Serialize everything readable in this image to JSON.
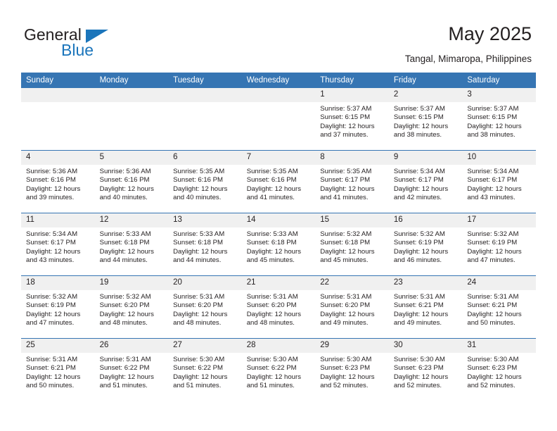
{
  "brand": {
    "name_top": "General",
    "name_bottom": "Blue",
    "accent_color": "#1b75bb"
  },
  "header": {
    "title": "May 2025",
    "location": "Tangal, Mimaropa, Philippines"
  },
  "theme": {
    "header_row_bg": "#3675b3",
    "daynum_bg": "#f0f0f0",
    "grid_line": "#3675b3",
    "text": "#231f20"
  },
  "weekday_headers": [
    "Sunday",
    "Monday",
    "Tuesday",
    "Wednesday",
    "Thursday",
    "Friday",
    "Saturday"
  ],
  "labels": {
    "sunrise": "Sunrise:",
    "sunset": "Sunset:",
    "daylight": "Daylight:"
  },
  "weeks": [
    [
      {
        "empty": true
      },
      {
        "empty": true
      },
      {
        "empty": true
      },
      {
        "empty": true
      },
      {
        "day": "1",
        "sunrise": "Sunrise: 5:37 AM",
        "sunset": "Sunset: 6:15 PM",
        "daylight_1": "Daylight: 12 hours",
        "daylight_2": "and 37 minutes."
      },
      {
        "day": "2",
        "sunrise": "Sunrise: 5:37 AM",
        "sunset": "Sunset: 6:15 PM",
        "daylight_1": "Daylight: 12 hours",
        "daylight_2": "and 38 minutes."
      },
      {
        "day": "3",
        "sunrise": "Sunrise: 5:37 AM",
        "sunset": "Sunset: 6:15 PM",
        "daylight_1": "Daylight: 12 hours",
        "daylight_2": "and 38 minutes."
      }
    ],
    [
      {
        "day": "4",
        "sunrise": "Sunrise: 5:36 AM",
        "sunset": "Sunset: 6:16 PM",
        "daylight_1": "Daylight: 12 hours",
        "daylight_2": "and 39 minutes."
      },
      {
        "day": "5",
        "sunrise": "Sunrise: 5:36 AM",
        "sunset": "Sunset: 6:16 PM",
        "daylight_1": "Daylight: 12 hours",
        "daylight_2": "and 40 minutes."
      },
      {
        "day": "6",
        "sunrise": "Sunrise: 5:35 AM",
        "sunset": "Sunset: 6:16 PM",
        "daylight_1": "Daylight: 12 hours",
        "daylight_2": "and 40 minutes."
      },
      {
        "day": "7",
        "sunrise": "Sunrise: 5:35 AM",
        "sunset": "Sunset: 6:16 PM",
        "daylight_1": "Daylight: 12 hours",
        "daylight_2": "and 41 minutes."
      },
      {
        "day": "8",
        "sunrise": "Sunrise: 5:35 AM",
        "sunset": "Sunset: 6:17 PM",
        "daylight_1": "Daylight: 12 hours",
        "daylight_2": "and 41 minutes."
      },
      {
        "day": "9",
        "sunrise": "Sunrise: 5:34 AM",
        "sunset": "Sunset: 6:17 PM",
        "daylight_1": "Daylight: 12 hours",
        "daylight_2": "and 42 minutes."
      },
      {
        "day": "10",
        "sunrise": "Sunrise: 5:34 AM",
        "sunset": "Sunset: 6:17 PM",
        "daylight_1": "Daylight: 12 hours",
        "daylight_2": "and 43 minutes."
      }
    ],
    [
      {
        "day": "11",
        "sunrise": "Sunrise: 5:34 AM",
        "sunset": "Sunset: 6:17 PM",
        "daylight_1": "Daylight: 12 hours",
        "daylight_2": "and 43 minutes."
      },
      {
        "day": "12",
        "sunrise": "Sunrise: 5:33 AM",
        "sunset": "Sunset: 6:18 PM",
        "daylight_1": "Daylight: 12 hours",
        "daylight_2": "and 44 minutes."
      },
      {
        "day": "13",
        "sunrise": "Sunrise: 5:33 AM",
        "sunset": "Sunset: 6:18 PM",
        "daylight_1": "Daylight: 12 hours",
        "daylight_2": "and 44 minutes."
      },
      {
        "day": "14",
        "sunrise": "Sunrise: 5:33 AM",
        "sunset": "Sunset: 6:18 PM",
        "daylight_1": "Daylight: 12 hours",
        "daylight_2": "and 45 minutes."
      },
      {
        "day": "15",
        "sunrise": "Sunrise: 5:32 AM",
        "sunset": "Sunset: 6:18 PM",
        "daylight_1": "Daylight: 12 hours",
        "daylight_2": "and 45 minutes."
      },
      {
        "day": "16",
        "sunrise": "Sunrise: 5:32 AM",
        "sunset": "Sunset: 6:19 PM",
        "daylight_1": "Daylight: 12 hours",
        "daylight_2": "and 46 minutes."
      },
      {
        "day": "17",
        "sunrise": "Sunrise: 5:32 AM",
        "sunset": "Sunset: 6:19 PM",
        "daylight_1": "Daylight: 12 hours",
        "daylight_2": "and 47 minutes."
      }
    ],
    [
      {
        "day": "18",
        "sunrise": "Sunrise: 5:32 AM",
        "sunset": "Sunset: 6:19 PM",
        "daylight_1": "Daylight: 12 hours",
        "daylight_2": "and 47 minutes."
      },
      {
        "day": "19",
        "sunrise": "Sunrise: 5:32 AM",
        "sunset": "Sunset: 6:20 PM",
        "daylight_1": "Daylight: 12 hours",
        "daylight_2": "and 48 minutes."
      },
      {
        "day": "20",
        "sunrise": "Sunrise: 5:31 AM",
        "sunset": "Sunset: 6:20 PM",
        "daylight_1": "Daylight: 12 hours",
        "daylight_2": "and 48 minutes."
      },
      {
        "day": "21",
        "sunrise": "Sunrise: 5:31 AM",
        "sunset": "Sunset: 6:20 PM",
        "daylight_1": "Daylight: 12 hours",
        "daylight_2": "and 48 minutes."
      },
      {
        "day": "22",
        "sunrise": "Sunrise: 5:31 AM",
        "sunset": "Sunset: 6:20 PM",
        "daylight_1": "Daylight: 12 hours",
        "daylight_2": "and 49 minutes."
      },
      {
        "day": "23",
        "sunrise": "Sunrise: 5:31 AM",
        "sunset": "Sunset: 6:21 PM",
        "daylight_1": "Daylight: 12 hours",
        "daylight_2": "and 49 minutes."
      },
      {
        "day": "24",
        "sunrise": "Sunrise: 5:31 AM",
        "sunset": "Sunset: 6:21 PM",
        "daylight_1": "Daylight: 12 hours",
        "daylight_2": "and 50 minutes."
      }
    ],
    [
      {
        "day": "25",
        "sunrise": "Sunrise: 5:31 AM",
        "sunset": "Sunset: 6:21 PM",
        "daylight_1": "Daylight: 12 hours",
        "daylight_2": "and 50 minutes."
      },
      {
        "day": "26",
        "sunrise": "Sunrise: 5:31 AM",
        "sunset": "Sunset: 6:22 PM",
        "daylight_1": "Daylight: 12 hours",
        "daylight_2": "and 51 minutes."
      },
      {
        "day": "27",
        "sunrise": "Sunrise: 5:30 AM",
        "sunset": "Sunset: 6:22 PM",
        "daylight_1": "Daylight: 12 hours",
        "daylight_2": "and 51 minutes."
      },
      {
        "day": "28",
        "sunrise": "Sunrise: 5:30 AM",
        "sunset": "Sunset: 6:22 PM",
        "daylight_1": "Daylight: 12 hours",
        "daylight_2": "and 51 minutes."
      },
      {
        "day": "29",
        "sunrise": "Sunrise: 5:30 AM",
        "sunset": "Sunset: 6:23 PM",
        "daylight_1": "Daylight: 12 hours",
        "daylight_2": "and 52 minutes."
      },
      {
        "day": "30",
        "sunrise": "Sunrise: 5:30 AM",
        "sunset": "Sunset: 6:23 PM",
        "daylight_1": "Daylight: 12 hours",
        "daylight_2": "and 52 minutes."
      },
      {
        "day": "31",
        "sunrise": "Sunrise: 5:30 AM",
        "sunset": "Sunset: 6:23 PM",
        "daylight_1": "Daylight: 12 hours",
        "daylight_2": "and 52 minutes."
      }
    ]
  ]
}
